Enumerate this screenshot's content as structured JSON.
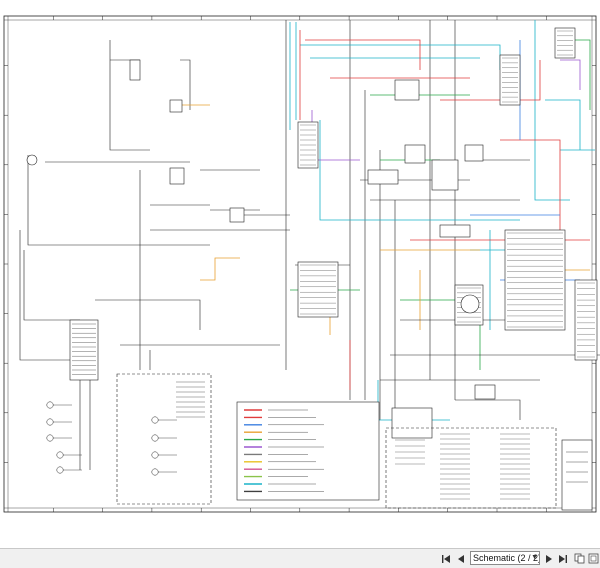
{
  "toolbar": {
    "page_selector_value": "Schematic (2 / 2)",
    "first_icon": "skip-to-first-icon",
    "prev_icon": "previous-page-icon",
    "next_icon": "next-page-icon",
    "last_icon": "skip-to-last-icon",
    "copy_icon": "copy-icon",
    "fit_icon": "fit-page-icon"
  },
  "legend": {
    "entries": [
      {
        "color": "#e03c3c"
      },
      {
        "color": "#e03c3c"
      },
      {
        "color": "#3c7fe0"
      },
      {
        "color": "#e8a030"
      },
      {
        "color": "#2aa84a"
      },
      {
        "color": "#9b59d0"
      },
      {
        "color": "#7a7a7a"
      },
      {
        "color": "#e8c020"
      },
      {
        "color": "#d05090"
      },
      {
        "color": "#8bc34a"
      },
      {
        "color": "#1ab3c8"
      },
      {
        "color": "#404040"
      }
    ]
  },
  "colors": {
    "wire_red": "#e03c3c",
    "wire_blue": "#3c7fe0",
    "wire_green": "#2aa84a",
    "wire_cyan": "#1ab3c8",
    "wire_orange": "#e8a030",
    "wire_black": "#222222",
    "toolbar_bg": "#f0f0f0"
  }
}
